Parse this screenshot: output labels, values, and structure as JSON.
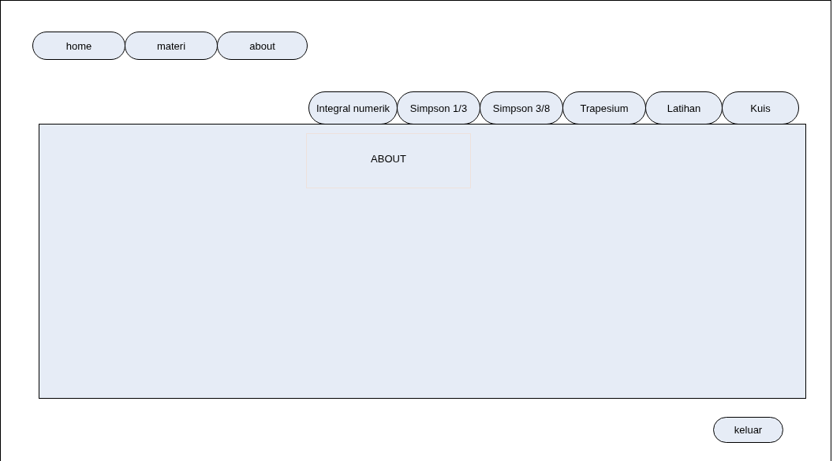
{
  "nav": [
    {
      "label": "home"
    },
    {
      "label": "materi"
    },
    {
      "label": "about"
    }
  ],
  "tabs": [
    {
      "label": "Integral numerik"
    },
    {
      "label": "Simpson 1/3"
    },
    {
      "label": "Simpson 3/8"
    },
    {
      "label": "Trapesium"
    },
    {
      "label": "Latihan"
    },
    {
      "label": "Kuis"
    }
  ],
  "panel": {
    "heading": "ABOUT"
  },
  "exit_button": "keluar"
}
